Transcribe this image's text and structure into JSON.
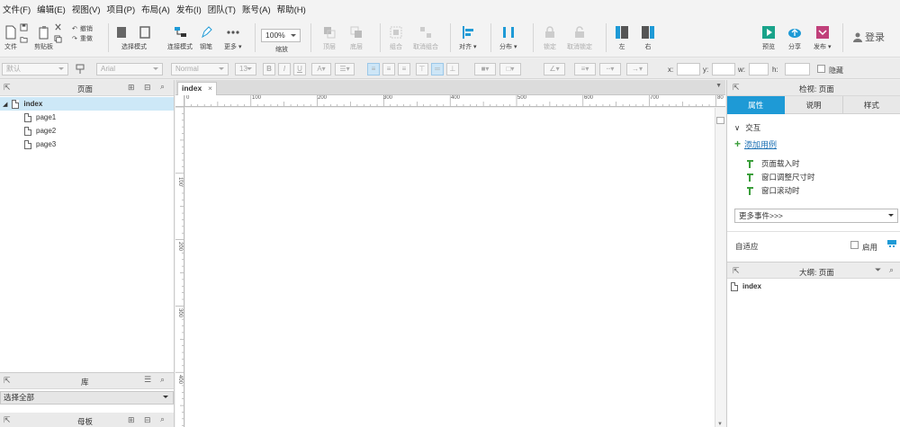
{
  "menu": [
    "文件(F)",
    "编辑(E)",
    "视图(V)",
    "项目(P)",
    "布局(A)",
    "发布(I)",
    "团队(T)",
    "账号(A)",
    "帮助(H)"
  ],
  "toolbar": {
    "file": "文件",
    "clipboard": "剪贴板",
    "cut": "剪切",
    "undo": "撤销",
    "redo": "重做",
    "select_mode": "选择模式",
    "connect_mode": "连接模式",
    "pen": "钢笔",
    "more": "更多 ▾",
    "zoom_value": "100%",
    "zoom_label": "缩放",
    "top": "顶层",
    "bottom": "底层",
    "group": "组合",
    "ungroup": "取消组合",
    "align": "对齐 ▾",
    "distribute": "分布 ▾",
    "lock": "锁定",
    "unlock": "取消锁定",
    "left": "左",
    "right": "右",
    "preview": "预览",
    "share": "分享",
    "publish": "发布 ▾",
    "login": "登录"
  },
  "format": {
    "style": "默认",
    "font": "Arial",
    "weight": "Normal",
    "size": "13",
    "x_label": "x:",
    "y_label": "y:",
    "w_label": "w:",
    "h_label": "h:",
    "hide_label": "隐藏"
  },
  "left_panel": {
    "pages_title": "页面",
    "pages": [
      {
        "name": "index",
        "level": 0,
        "selected": true
      },
      {
        "name": "page1",
        "level": 1,
        "selected": false
      },
      {
        "name": "page2",
        "level": 1,
        "selected": false
      },
      {
        "name": "page3",
        "level": 1,
        "selected": false
      }
    ],
    "library_title": "库",
    "library_select": "选择全部",
    "masters_title": "母板"
  },
  "canvas": {
    "tab_name": "index",
    "ruler_h": [
      "0",
      "100",
      "200",
      "300",
      "400",
      "500",
      "600",
      "700",
      "80"
    ],
    "ruler_v": [
      "100",
      "200",
      "300",
      "400"
    ]
  },
  "right_panel": {
    "inspect_title": "检视: 页面",
    "tabs": [
      "属性",
      "说明",
      "样式"
    ],
    "interaction_title": "交互",
    "add_case": "添加用例",
    "events": [
      "页面载入时",
      "窗口调整尺寸时",
      "窗口滚动时"
    ],
    "more_events": "更多事件>>>",
    "adaptive_label": "自适应",
    "enable_label": "启用",
    "outline_title": "大纲: 页面",
    "outline_item": "index"
  },
  "colors": {
    "accent": "#1e9ad6",
    "link": "#1a6fb3",
    "green": "#3a9e3a",
    "selection": "#cde8f7"
  }
}
